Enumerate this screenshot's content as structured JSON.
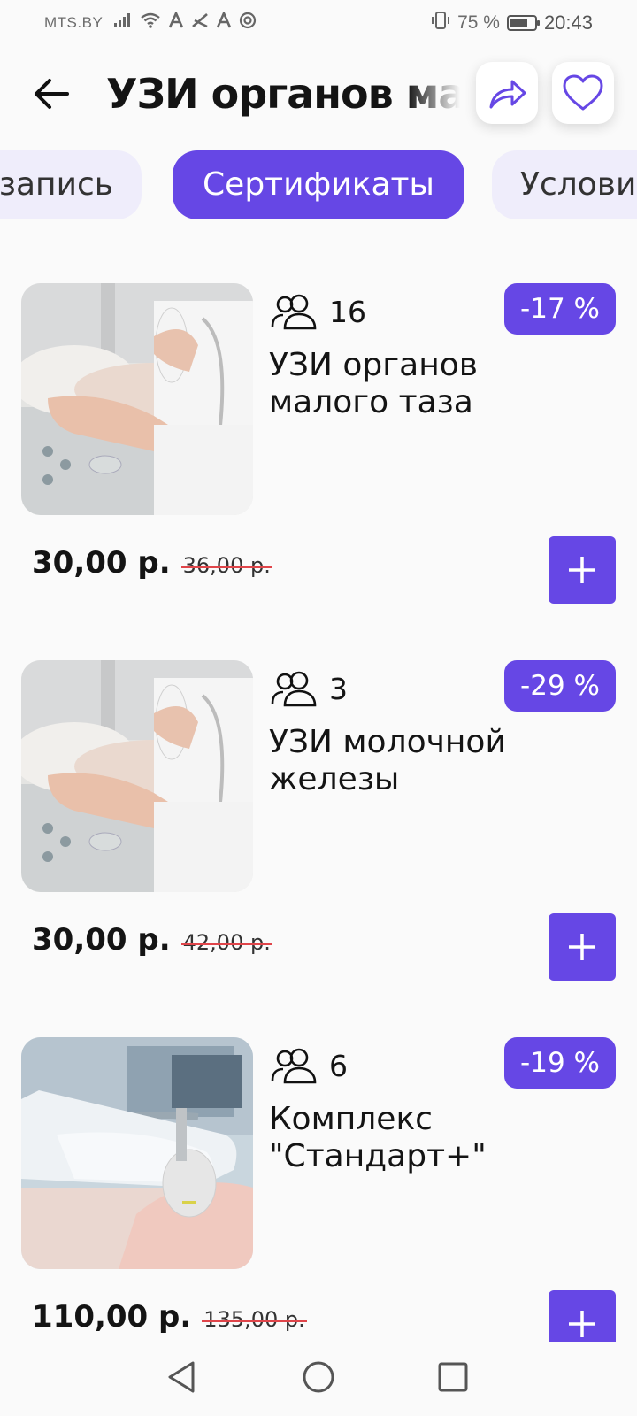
{
  "status_bar": {
    "carrier": "MTS.BY",
    "battery_percent_text": "75 %",
    "battery_level": 0.75,
    "time": "20:43",
    "icons": [
      "signal-icon",
      "wifi-icon",
      "a-icon",
      "nfc-icon",
      "a-icon",
      "at-icon",
      "vibrate-icon",
      "battery-icon"
    ]
  },
  "header": {
    "title": "УЗИ органов малого таза",
    "back_icon": "arrow-left-icon",
    "share_icon": "share-icon",
    "favorite_icon": "heart-icon"
  },
  "tabs": [
    {
      "label": "запись",
      "active": false
    },
    {
      "label": "Сертификаты",
      "active": true
    },
    {
      "label": "Условия",
      "active": false
    }
  ],
  "items": [
    {
      "buyers": "16",
      "discount": "-17 %",
      "title": "УЗИ органов малого таза",
      "price": "30,00 р.",
      "old_price": "36,00 р."
    },
    {
      "buyers": "3",
      "discount": "-29 %",
      "title": "УЗИ молочной железы",
      "price": "30,00 р.",
      "old_price": "42,00 р."
    },
    {
      "buyers": "6",
      "discount": "-19 %",
      "title": "Комплекс \"Стандарт+\"",
      "price": "110,00 р.",
      "old_price": "135,00 р."
    }
  ],
  "colors": {
    "accent": "#6647e5",
    "tab_inactive_bg": "#efedfb",
    "strike": "#e0454a",
    "background": "#fafafa"
  },
  "nav": {
    "back": "triangle-back-icon",
    "home": "circle-home-icon",
    "recents": "square-recents-icon"
  }
}
